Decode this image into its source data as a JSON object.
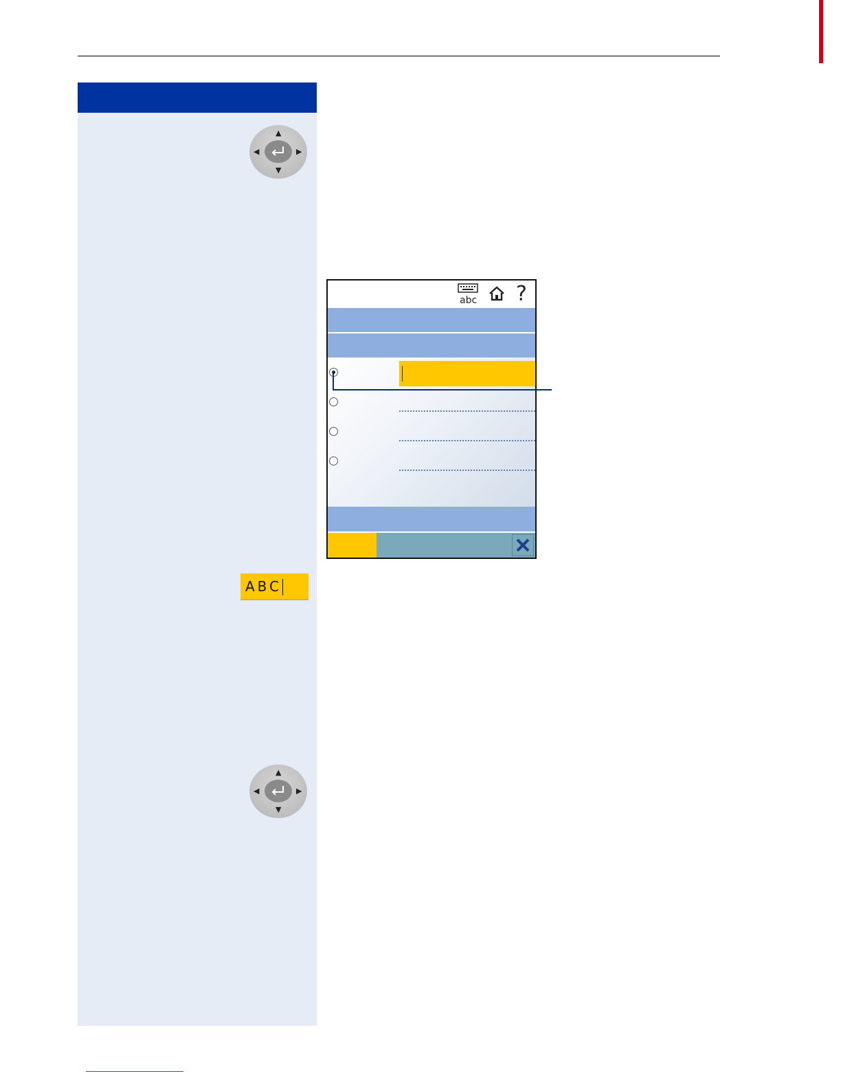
{
  "sidebar": {
    "abc_field_value": "ABC"
  },
  "icons": {
    "nav_key": "navigation-key-icon",
    "keyboard_abc": "keyboard-abc-icon",
    "home": "home-icon",
    "help": "help-icon",
    "close": "close-icon"
  },
  "phone_screen": {
    "status_icons": {
      "keyboard_label": "abc",
      "help_label": "?"
    },
    "options": [
      {
        "selected": true
      },
      {
        "selected": false
      },
      {
        "selected": false
      },
      {
        "selected": false
      }
    ]
  },
  "colors": {
    "header_blue": "#0033a0",
    "sidebar_bg": "#e6ecf5",
    "highlight_yellow": "#ffc700",
    "band_blue": "#8eaedf",
    "softkey_teal": "#7aa9bc",
    "accent_red": "#d0021b"
  }
}
